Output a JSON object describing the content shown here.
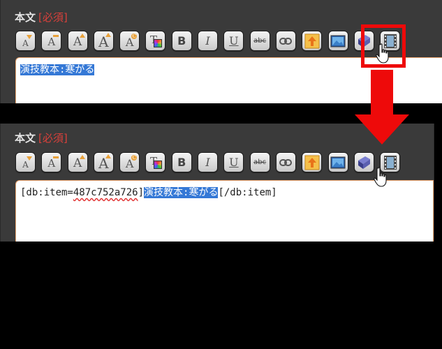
{
  "label": {
    "field": "本文",
    "required": "[必須]"
  },
  "editor_top": {
    "selected_text": "演技教本:寒がる"
  },
  "editor_bottom": {
    "prefix": "[db:item=",
    "item_id": "487c752a726",
    "mid": "]",
    "selected_text": "演技教本:寒がる",
    "suffix": "[/db:item]"
  },
  "toolbar": [
    {
      "name": "font-size-down-button",
      "glyph": "A",
      "icon": "font-size-down-icon"
    },
    {
      "name": "font-size-small-button",
      "glyph": "A",
      "icon": "font-size-small-icon"
    },
    {
      "name": "font-size-up-button",
      "glyph": "A",
      "icon": "font-size-up-icon"
    },
    {
      "name": "font-size-large-button",
      "glyph": "A",
      "icon": "font-size-large-icon"
    },
    {
      "name": "font-color-button",
      "glyph": "A",
      "icon": "font-color-icon"
    },
    {
      "name": "text-color-button",
      "glyph": "T",
      "icon": "text-palette-icon"
    },
    {
      "name": "bold-button",
      "glyph": "B",
      "icon": "bold-icon"
    },
    {
      "name": "italic-button",
      "glyph": "I",
      "icon": "italic-icon"
    },
    {
      "name": "underline-button",
      "glyph": "U",
      "icon": "underline-icon"
    },
    {
      "name": "strikethrough-button",
      "glyph": "abc",
      "icon": "strikethrough-icon"
    },
    {
      "name": "link-button",
      "glyph": "",
      "icon": "link-icon"
    },
    {
      "name": "upload-button",
      "glyph": "",
      "icon": "upload-icon"
    },
    {
      "name": "image-button",
      "glyph": "",
      "icon": "image-icon"
    },
    {
      "name": "db-item-button",
      "glyph": "",
      "icon": "book-icon"
    },
    {
      "name": "video-button",
      "glyph": "",
      "icon": "film-icon"
    }
  ],
  "colors": {
    "accent_red": "#ee0a0a",
    "selection": "#3478d6",
    "required": "#d9403a"
  }
}
